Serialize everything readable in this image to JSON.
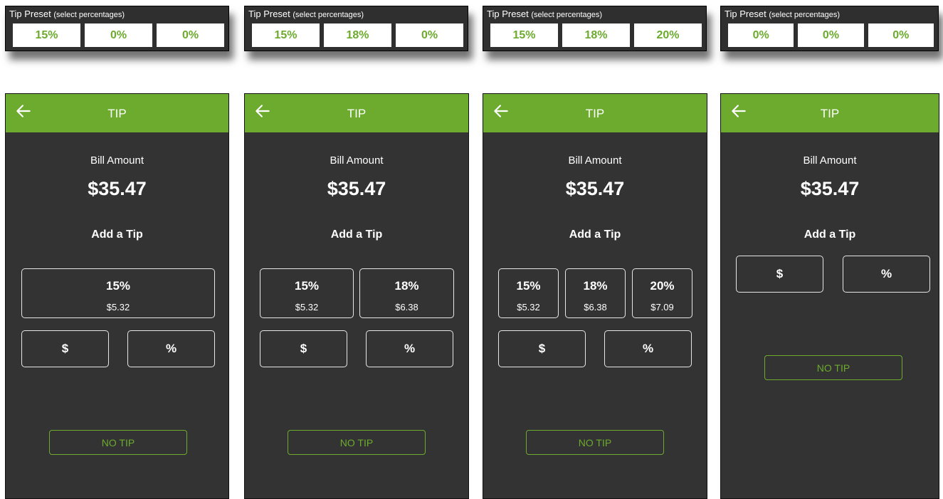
{
  "presets": [
    {
      "title": "Tip Preset",
      "subtitle": "(select percentages)",
      "values": [
        "15%",
        "0%",
        "0%"
      ]
    },
    {
      "title": "Tip Preset",
      "subtitle": "(select percentages)",
      "values": [
        "15%",
        "18%",
        "0%"
      ]
    },
    {
      "title": "Tip Preset",
      "subtitle": "(select percentages)",
      "values": [
        "15%",
        "18%",
        "20%"
      ]
    },
    {
      "title": "Tip Preset",
      "subtitle": "(select percentages)",
      "values": [
        "0%",
        "0%",
        "0%"
      ]
    }
  ],
  "screens": [
    {
      "header_title": "TIP",
      "bill_label": "Bill Amount",
      "bill_amount": "$35.47",
      "add_tip": "Add a Tip",
      "tips": [
        {
          "pct": "15%",
          "amount": "$5.32"
        }
      ],
      "dollar_label": "$",
      "percent_label": "%",
      "no_tip_label": "NO TIP"
    },
    {
      "header_title": "TIP",
      "bill_label": "Bill Amount",
      "bill_amount": "$35.47",
      "add_tip": "Add a Tip",
      "tips": [
        {
          "pct": "15%",
          "amount": "$5.32"
        },
        {
          "pct": "18%",
          "amount": "$6.38"
        }
      ],
      "dollar_label": "$",
      "percent_label": "%",
      "no_tip_label": "NO TIP"
    },
    {
      "header_title": "TIP",
      "bill_label": "Bill Amount",
      "bill_amount": "$35.47",
      "add_tip": "Add a Tip",
      "tips": [
        {
          "pct": "15%",
          "amount": "$5.32"
        },
        {
          "pct": "18%",
          "amount": "$6.38"
        },
        {
          "pct": "20%",
          "amount": "$7.09"
        }
      ],
      "dollar_label": "$",
      "percent_label": "%",
      "no_tip_label": "NO TIP"
    },
    {
      "header_title": "TIP",
      "bill_label": "Bill Amount",
      "bill_amount": "$35.47",
      "add_tip": "Add a Tip",
      "tips": [],
      "dollar_label": "$",
      "percent_label": "%",
      "no_tip_label": "NO TIP"
    }
  ],
  "colors": {
    "accent": "#6cab2e",
    "screen_bg": "#333333",
    "preset_bg": "#2f2f2f",
    "text": "#ffffff"
  },
  "icons": {
    "back": "arrow-left-icon"
  }
}
